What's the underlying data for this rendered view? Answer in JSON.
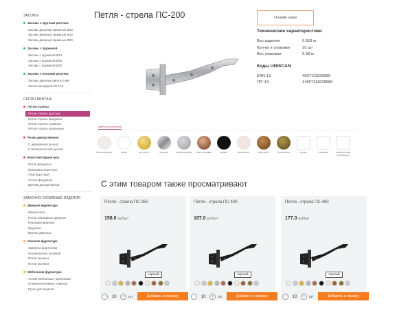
{
  "sidebar": {
    "head1": "Засовы",
    "g1": {
      "title": "Засовы с круглым ригелем",
      "color": "#2bb673",
      "items": [
        "Засовы дверные гаражные Ø13",
        "Засовы дверные гаражные Ø16",
        "Засовы дверные гаражные Ø20"
      ]
    },
    "g2": {
      "title": "Засовы с пружиной",
      "color": "#2bb673",
      "items": [
        "Засовы с пружиной Ø13",
        "Засовы с пружиной Ø16",
        "Засовы с пружиной Ø20"
      ]
    },
    "g3": {
      "title": "Засовы с плоским ригелем",
      "color": "#2bb673",
      "items": [
        "Засовы дверные ригель 5 мм",
        "Засов накладной ЗН-175"
      ]
    },
    "head2": "Серия винтаж",
    "g4": {
      "title": "Петли-стрелы",
      "color": "#e0447a",
      "items": [
        "Петли-стрелы простые",
        "Петли-стрелы фигурные",
        "Петли-стрелы съемные",
        "Петли-стрелы усиленные"
      ]
    },
    "g5": {
      "title": "Ручки декоративные",
      "color": "#e0447a",
      "items": [
        "С деревянной ручкой",
        "С металлической ручкой"
      ]
    },
    "g6": {
      "title": "Воротная фурнитура",
      "color": "#e0447a",
      "items": [
        "Петли фигурные",
        "Проушины воротные",
        "Упор воротный",
        "Уголок фигурный",
        "Крепеж декоративный"
      ]
    },
    "head3": "Замочно-скобяные изделия",
    "g7": {
      "title": "Дверная фурнитура",
      "color": "#f5a623",
      "items": [
        "Шпингалеты",
        "Петли накладные дверные",
        "Накладки дверные",
        "Пружины",
        "Крючки дверные"
      ]
    },
    "g8": {
      "title": "Оконная фурнитура",
      "color": "#f5a623",
      "items": [
        "Завертка форточная",
        "Ограничитель оконный",
        "Петли оконные",
        "Петли оконные"
      ]
    },
    "g9": {
      "title": "Мебельная фурнитура",
      "color": "#f5a623",
      "items": [
        "Уголки мебельные, крепежные",
        "Планки крепежные, навески",
        "Ручки для ящиков"
      ]
    }
  },
  "product": {
    "title": "Петля - стрела ПС-200",
    "order_label": "Онлайн заказ"
  },
  "specs": {
    "title": "Технические характеристики",
    "rows": [
      {
        "k": "Вес изделия",
        "v": "0.559 кг"
      },
      {
        "k": "Кол-во в упаковке",
        "v": "10 шт"
      },
      {
        "k": "Вес упаковки",
        "v": "5.68 кг"
      }
    ],
    "codes_title": "Коды UNISCAN",
    "codes": [
      {
        "k": "EAN-13",
        "v": "4607111628589"
      },
      {
        "k": "ITF-14",
        "v": "14607111628586"
      }
    ]
  },
  "color_tab": "Цвета исполнения",
  "colors": [
    {
      "name": "бело-жемчужное",
      "color": "#f0ecea"
    },
    {
      "name": "белый",
      "color": "#ffffff"
    },
    {
      "name": "под золото",
      "color": "#d8b640"
    },
    {
      "name": "под хром",
      "color": "#c9c9cb"
    },
    {
      "name": "серый металлик",
      "color": "#b5b6ba"
    },
    {
      "name": "бронз. антиквар",
      "color": "#a86a4a"
    },
    {
      "name": "черный",
      "color": "#111111"
    },
    {
      "name": "белый антик",
      "color": "#f1e6e0"
    },
    {
      "name": "медь антик",
      "color": "#9a6236"
    },
    {
      "name": "бронза антик",
      "color": "#8a6f2c"
    },
    {
      "name": "чертеж",
      "color": "#ffffff"
    },
    {
      "name": "в упаковке",
      "color": "#ffffff"
    },
    {
      "name": "схема монтажа информация",
      "color": "#ffffff"
    }
  ],
  "also_title": "С этим товаром также просматривают",
  "cards": [
    {
      "name": "Петля - стрела ПС-350",
      "price": "158.0",
      "unit": "руб/шт",
      "tip": "черный",
      "qty": "10",
      "qunit": "шт",
      "cart": "Добавить в корзину"
    },
    {
      "name": "Петля - стрела ПС-400",
      "price": "167.0",
      "unit": "руб/шт",
      "tip": "черный",
      "qty": "10",
      "qunit": "шт",
      "cart": "Добавить в корзину"
    },
    {
      "name": "Петля - стрела ПС-450",
      "price": "177.0",
      "unit": "руб/шт",
      "tip": "черный",
      "qty": "10",
      "qunit": "шт",
      "cart": "Добавить в корзину"
    }
  ],
  "mini_colors": [
    "#f0ecea",
    "#c9c9cb",
    "#d8b640",
    "#b5b6ba",
    "#a86a4a",
    "#111111",
    "#f1e6e0",
    "#9a6236",
    "#8a6f2c",
    "#c9c9cb"
  ]
}
